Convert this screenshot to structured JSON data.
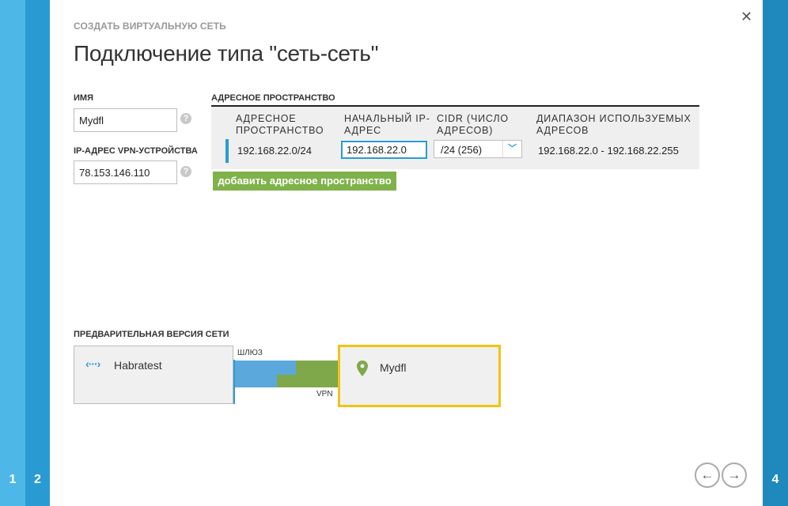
{
  "wizard": {
    "label": "СОЗДАТЬ ВИРТУАЛЬНУЮ СЕТЬ",
    "title": "Подключение типа \"сеть-сеть\"",
    "close_icon": "close-icon",
    "steps_left": [
      "1",
      "2"
    ],
    "step_right": "4"
  },
  "form": {
    "name_label": "ИМЯ",
    "name_value": "Mydfl",
    "vpn_label": "IP-АДРЕС VPN-УСТРОЙСТВА",
    "vpn_value": "78.153.146.110",
    "help_glyph": "?"
  },
  "address_space": {
    "section_label": "АДРЕСНОЕ ПРОСТРАНСТВО",
    "columns": [
      "АДРЕСНОЕ ПРОСТРАНСТВО",
      "НАЧАЛЬНЫЙ IP-АДРЕС",
      "CIDR (ЧИСЛО АДРЕСОВ)",
      "ДИАПАЗОН ИСПОЛЬЗУЕМЫХ АДРЕСОВ"
    ],
    "row": {
      "space": "192.168.22.0/24",
      "start_ip": "192.168.22.0",
      "cidr": "/24 (256)",
      "range": "192.168.22.0 - 192.168.22.255"
    },
    "add_button": "добавить адресное пространство"
  },
  "preview": {
    "label": "ПРЕДВАРИТЕЛЬНАЯ ВЕРСИЯ СЕТИ",
    "left_network": "Habratest",
    "gateway_label": "ШЛЮЗ",
    "vpn_label": "VPN",
    "right_network": "Mydfl"
  },
  "nav": {
    "back_glyph": "←",
    "next_glyph": "→"
  },
  "colors": {
    "accent_blue": "#2a9bd2",
    "button_green": "#7fb24a",
    "highlight_yellow": "#f2c314"
  }
}
